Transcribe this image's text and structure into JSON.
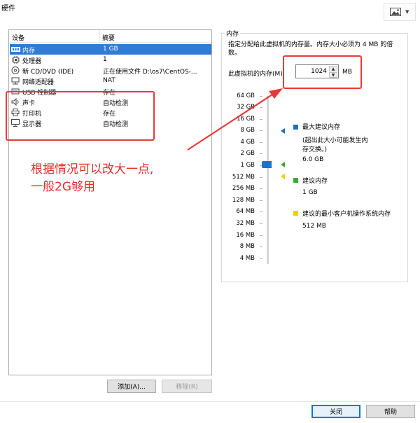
{
  "window": {
    "title": "硬件"
  },
  "toolbar": {
    "image_icon": "image-icon",
    "dropdown_icon": "chevron-down-icon"
  },
  "devices": {
    "headers": {
      "device": "设备",
      "summary": "摘要"
    },
    "rows": [
      {
        "name": "内存",
        "summary": "1 GB",
        "icon": "memory-icon",
        "selected": true
      },
      {
        "name": "处理器",
        "summary": "1",
        "icon": "cpu-icon",
        "selected": false
      },
      {
        "name": "新 CD/DVD (IDE)",
        "summary": "正在使用文件 D:\\os7\\CentOS-...",
        "icon": "cd-icon",
        "selected": false
      },
      {
        "name": "网络适配器",
        "summary": "NAT",
        "icon": "network-icon",
        "selected": false
      },
      {
        "name": "USB 控制器",
        "summary": "存在",
        "icon": "usb-icon",
        "selected": false
      },
      {
        "name": "声卡",
        "summary": "自动检测",
        "icon": "speaker-icon",
        "selected": false
      },
      {
        "name": "打印机",
        "summary": "存在",
        "icon": "printer-icon",
        "selected": false
      },
      {
        "name": "显示器",
        "summary": "自动检测",
        "icon": "monitor-icon",
        "selected": false
      }
    ],
    "add_label": "添加(A)...",
    "remove_label": "移除(R)"
  },
  "memory": {
    "group_label": "内存",
    "description": "指定分配给此虚拟机的内存量。内存大小必须为 4 MB 的倍数。",
    "field_label": "此虚拟机的内存(M):",
    "value": "1024",
    "unit": "MB",
    "scale": [
      "64 GB",
      "32 GB",
      "16 GB",
      "8 GB",
      "4 GB",
      "2 GB",
      "1 GB",
      "512 MB",
      "256 MB",
      "128 MB",
      "64 MB",
      "32 MB",
      "16 MB",
      "8 MB",
      "4 MB"
    ],
    "legend": [
      {
        "title": "最大建议内存",
        "note": "(超出此大小可能发生内存交换。)",
        "value": "6.0 GB",
        "color": "#1f6fbf"
      },
      {
        "title": "建议内存",
        "value": "1 GB",
        "color": "#3aa935"
      },
      {
        "title": "建议的最小客户机操作系统内存",
        "value": "512 MB",
        "color": "#f2cf00"
      }
    ]
  },
  "annotation": {
    "line1": "根据情况可以改大一点,",
    "line2": "一般2G够用",
    "color": "#e52e2e"
  },
  "footer": {
    "close_label": "关闭",
    "help_label": "帮助"
  }
}
